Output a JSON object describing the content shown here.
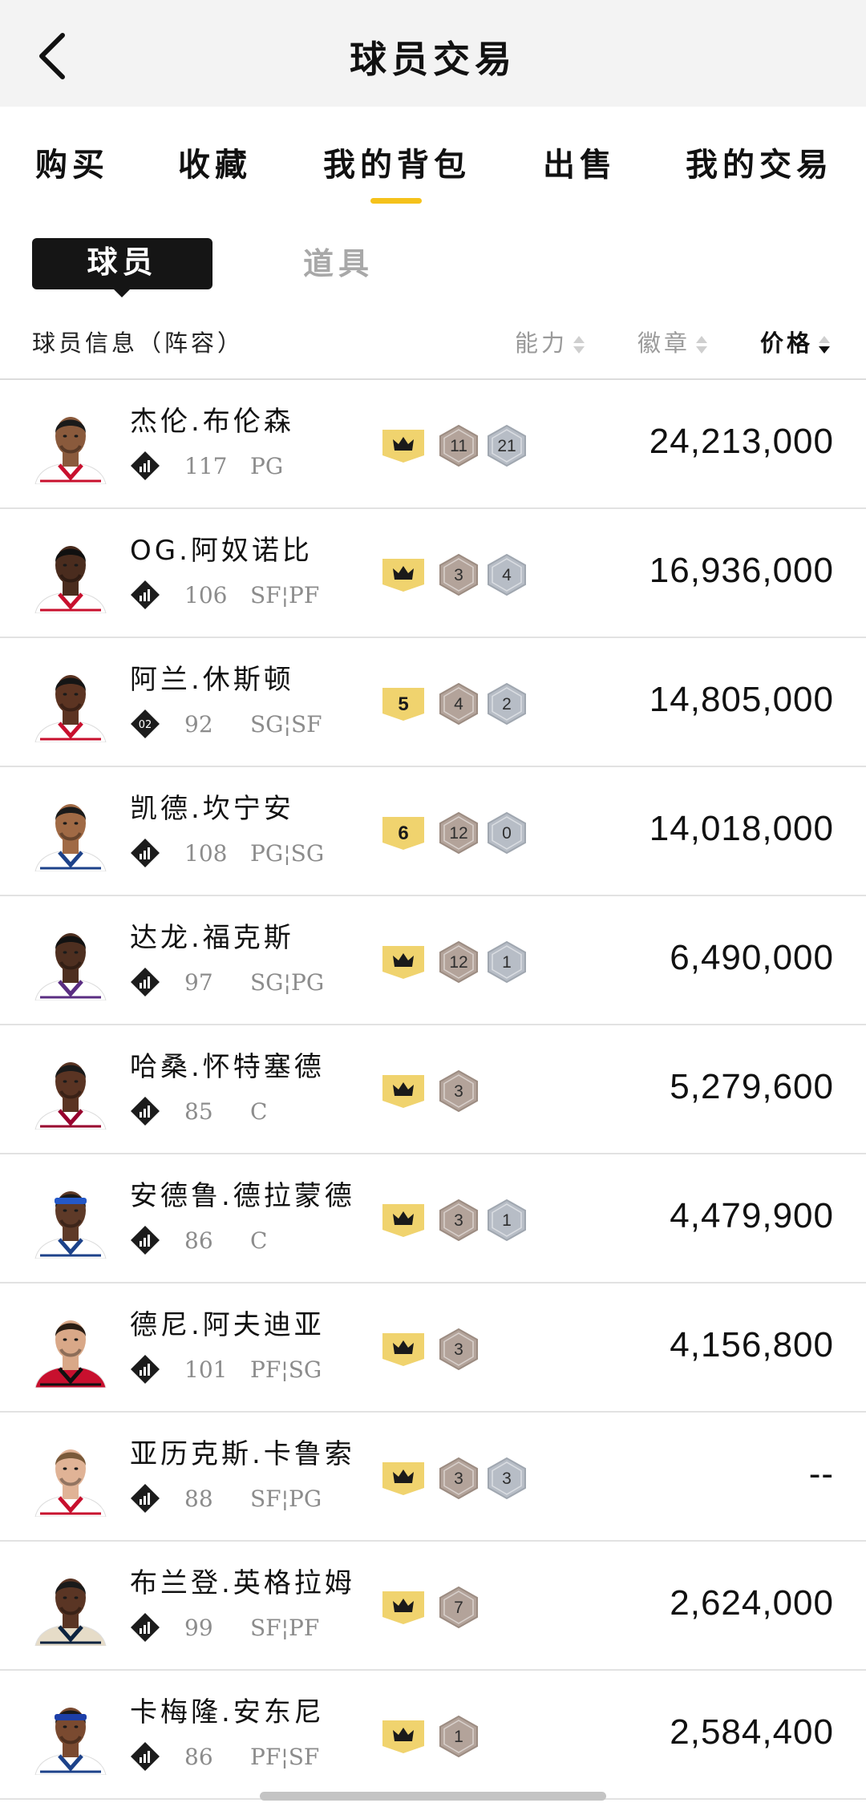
{
  "header": {
    "title": "球员交易",
    "back_icon": "chevron-left-icon"
  },
  "tabs": [
    {
      "label": "购买",
      "active": false
    },
    {
      "label": "收藏",
      "active": false
    },
    {
      "label": "我的背包",
      "active": true
    },
    {
      "label": "出售",
      "active": false
    },
    {
      "label": "我的交易",
      "active": false
    }
  ],
  "segments": {
    "players": "球员",
    "items": "道具",
    "active": "players"
  },
  "columns": {
    "info": "球员信息（阵容）",
    "ability": "能力",
    "badges": "徽章",
    "price": "价格",
    "price_sort": "descending"
  },
  "colors": {
    "accent": "#f5c21b",
    "tier_gold": "#f0d36e",
    "hex_bronze": "#b3a39a",
    "hex_silver": "#b7bdc6",
    "text_muted": "#8c8c8c"
  },
  "players": [
    {
      "name": "杰伦.布伦森",
      "rank": "",
      "rating": "117",
      "positions": "PG",
      "tier": "crown",
      "badge_a": "11",
      "badge_b": "21",
      "price": "24,213,000",
      "skin": "#8a5a3c",
      "jersey": "#ffffff",
      "trim": "#c8102e",
      "hair": "#1a1a1a",
      "band": ""
    },
    {
      "name": "OG.阿奴诺比",
      "rank": "",
      "rating": "106",
      "positions": "SF¦PF",
      "tier": "crown",
      "badge_a": "3",
      "badge_b": "4",
      "price": "16,936,000",
      "skin": "#4a2c1e",
      "jersey": "#ffffff",
      "trim": "#c8102e",
      "hair": "#101010",
      "band": ""
    },
    {
      "name": "阿兰.休斯顿",
      "rank": "02",
      "rating": "92",
      "positions": "SG¦SF",
      "tier": "5",
      "badge_a": "4",
      "badge_b": "2",
      "price": "14,805,000",
      "skin": "#5c3422",
      "jersey": "#ffffff",
      "trim": "#c8102e",
      "hair": "#151515",
      "band": ""
    },
    {
      "name": "凯德.坎宁安",
      "rank": "",
      "rating": "108",
      "positions": "PG¦SG",
      "tier": "6",
      "badge_a": "12",
      "badge_b": "0",
      "price": "14,018,000",
      "skin": "#a06a45",
      "jersey": "#ffffff",
      "trim": "#1d428a",
      "hair": "#1a1a1a",
      "band": ""
    },
    {
      "name": "达龙.福克斯",
      "rank": "",
      "rating": "97",
      "positions": "SG¦PG",
      "tier": "crown",
      "badge_a": "12",
      "badge_b": "1",
      "price": "6,490,000",
      "skin": "#4e2f20",
      "jersey": "#ffffff",
      "trim": "#5a2d82",
      "hair": "#121212",
      "band": ""
    },
    {
      "name": "哈桑.怀特塞德",
      "rank": "",
      "rating": "85",
      "positions": "C",
      "tier": "crown",
      "badge_a": "3",
      "badge_b": "",
      "price": "5,279,600",
      "skin": "#5a3423",
      "jersey": "#ffffff",
      "trim": "#98002e",
      "hair": "#1a1a1a",
      "band": ""
    },
    {
      "name": "安德鲁.德拉蒙德",
      "rank": "",
      "rating": "86",
      "positions": "C",
      "tier": "crown",
      "badge_a": "3",
      "badge_b": "1",
      "price": "4,479,900",
      "skin": "#5e3a28",
      "jersey": "#ffffff",
      "trim": "#1d428a",
      "hair": "#1a1a1a",
      "band": "#2458c8"
    },
    {
      "name": "德尼.阿夫迪亚",
      "rank": "",
      "rating": "101",
      "positions": "PF¦SG",
      "tier": "crown",
      "badge_a": "3",
      "badge_b": "",
      "price": "4,156,800",
      "skin": "#d9a888",
      "jersey": "#c8102e",
      "trim": "#111111",
      "hair": "#2a1d14",
      "band": ""
    },
    {
      "name": "亚历克斯.卡鲁索",
      "rank": "",
      "rating": "88",
      "positions": "SF¦PG",
      "tier": "crown",
      "badge_a": "3",
      "badge_b": "3",
      "price": "--",
      "skin": "#e0b396",
      "jersey": "#ffffff",
      "trim": "#c8102e",
      "hair": "#7a5a3a",
      "band": ""
    },
    {
      "name": "布兰登.英格拉姆",
      "rank": "",
      "rating": "99",
      "positions": "SF¦PF",
      "tier": "crown",
      "badge_a": "7",
      "badge_b": "",
      "price": "2,624,000",
      "skin": "#5a3524",
      "jersey": "#e6dcc8",
      "trim": "#0c2340",
      "hair": "#1a1a1a",
      "band": ""
    },
    {
      "name": "卡梅隆.安东尼",
      "rank": "",
      "rating": "86",
      "positions": "PF¦SF",
      "tier": "crown",
      "badge_a": "1",
      "badge_b": "",
      "price": "2,584,400",
      "skin": "#7a4a30",
      "jersey": "#ffffff",
      "trim": "#1d428a",
      "hair": "#1a1a1a",
      "band": "#1d3fa8"
    }
  ]
}
